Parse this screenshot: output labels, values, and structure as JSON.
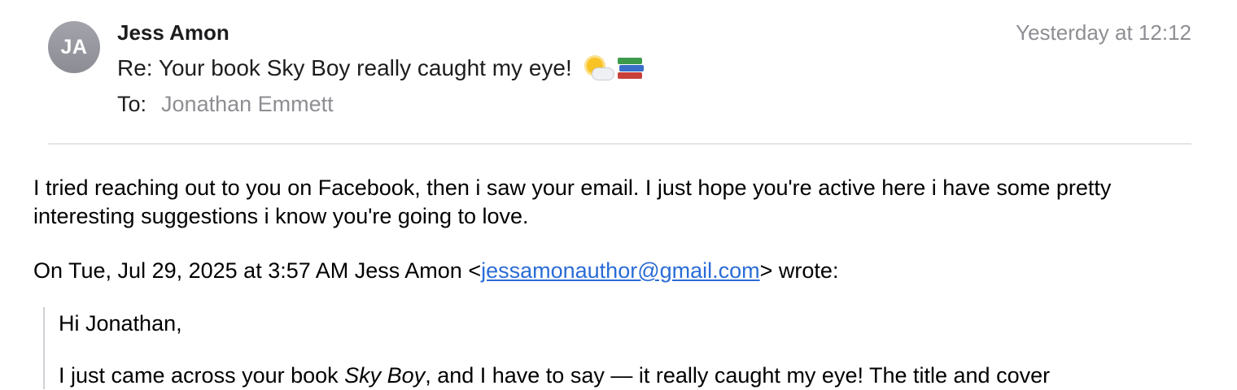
{
  "header": {
    "avatar_initials": "JA",
    "sender_name": "Jess Amon",
    "date": "Yesterday at 12:12",
    "subject": "Re: Your book Sky Boy really caught my eye!",
    "subject_emojis": [
      "sun-behind-cloud-icon",
      "books-icon"
    ],
    "to_label": "To:",
    "to_value": "Jonathan Emmett"
  },
  "body": {
    "paragraph1": "I tried reaching out to you on Facebook, then i saw your email. I just hope you're active here i have some pretty interesting suggestions i know you're going to love.",
    "quote_intro_prefix": "On Tue, Jul 29, 2025 at 3:57 AM Jess Amon <",
    "quote_intro_email": "jessamonauthor@gmail.com",
    "quote_intro_suffix": "> wrote:",
    "quote_greeting": "Hi Jonathan,",
    "quote_line2_prefix": "I just came across your book ",
    "quote_line2_italic": "Sky Boy",
    "quote_line2_suffix": ", and I have to say — it really caught my eye! The title and cover"
  },
  "colors": {
    "link": "#2a6cd6",
    "muted": "#8e8e93",
    "avatar": "#9a9ba2",
    "divider": "#e5e5e7"
  }
}
